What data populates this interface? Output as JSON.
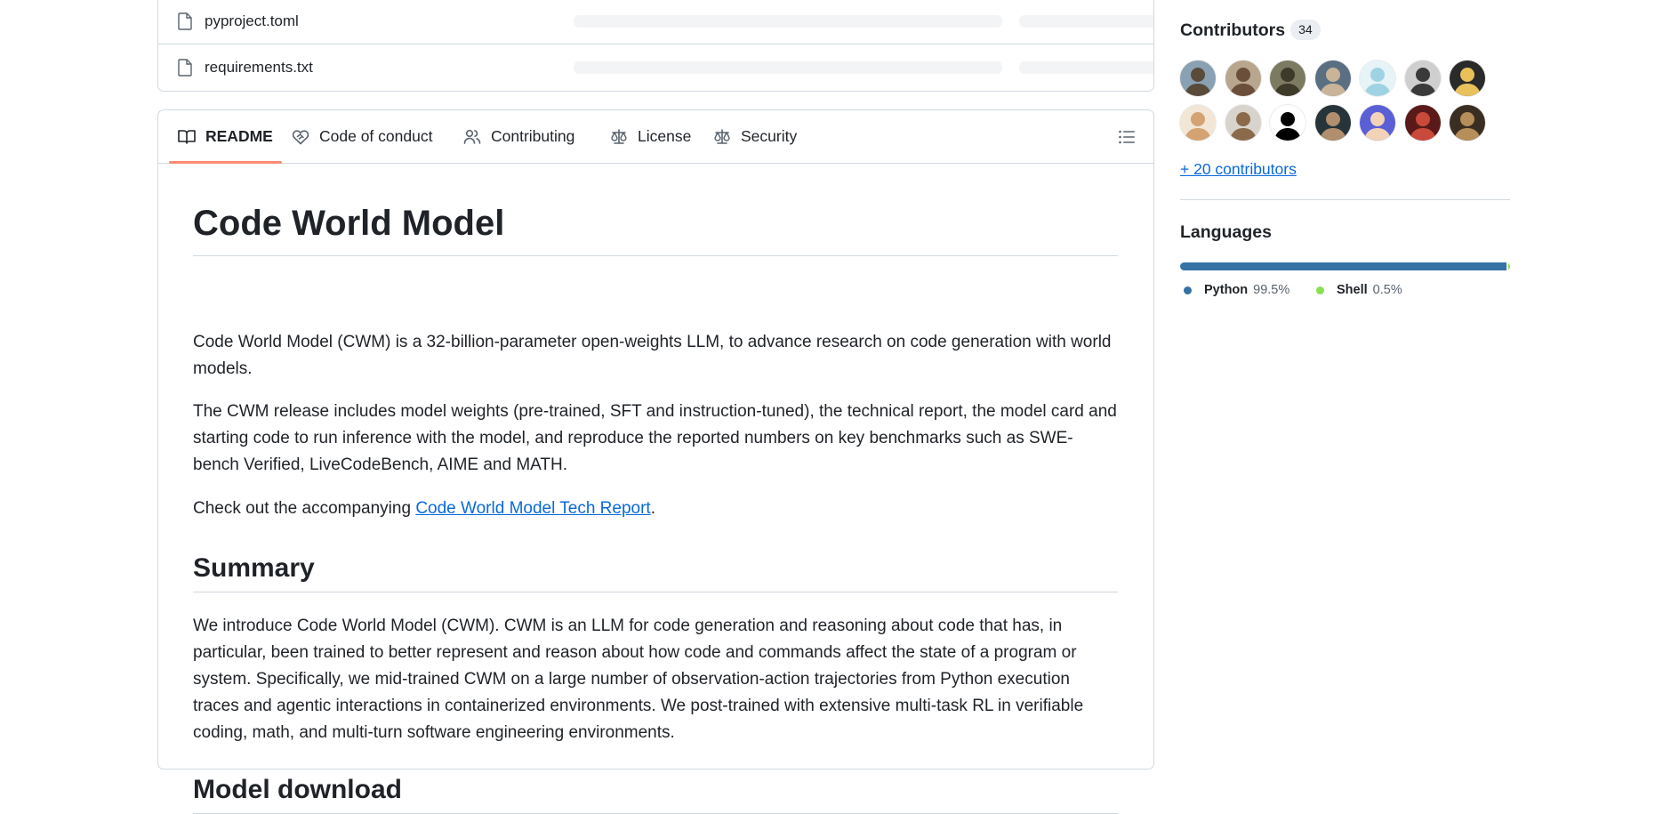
{
  "files": [
    {
      "name": "pyproject.toml"
    },
    {
      "name": "requirements.txt"
    }
  ],
  "readme_tabs": [
    {
      "label": "README",
      "icon": "book-icon",
      "active": true
    },
    {
      "label": "Code of conduct",
      "icon": "heart-handshake-icon",
      "active": false
    },
    {
      "label": "Contributing",
      "icon": "people-icon",
      "active": false
    },
    {
      "label": "License",
      "icon": "law-scale-icon",
      "active": false
    },
    {
      "label": "Security",
      "icon": "law-scale-icon",
      "active": false
    }
  ],
  "readme": {
    "title": "Code World Model",
    "intro": "Code World Model (CWM) is a 32-billion-parameter open-weights LLM, to advance research on code generation with world models.",
    "release": "The CWM release includes model weights (pre-trained, SFT and instruction-tuned), the technical report, the model card and starting code to run inference with the model, and reproduce the reported numbers on key benchmarks such as SWE-bench Verified, LiveCodeBench, AIME and MATH.",
    "check_prefix": "Check out the accompanying ",
    "check_link": "Code World Model Tech Report",
    "check_suffix": ".",
    "summary_heading": "Summary",
    "summary_text": "We introduce Code World Model (CWM). CWM is an LLM for code generation and reasoning about code that has, in particular, been trained to better represent and reason about how code and commands affect the state of a program or system. Specifically, we mid-trained CWM on a large number of observation-action trajectories from Python execution traces and agentic interactions in containerized environments. We post-trained with extensive multi-task RL in verifiable coding, math, and multi-turn software engineering environments.",
    "download_heading": "Model download"
  },
  "sidebar": {
    "contributors": {
      "title": "Contributors",
      "count": "34",
      "more_label": "+ 20 contributors",
      "avatars": [
        {
          "bg": "#8aa1b3",
          "fg": "#5a4a3a"
        },
        {
          "bg": "#b9a68f",
          "fg": "#6b4f3a"
        },
        {
          "bg": "#7d7a62",
          "fg": "#3d3a2a"
        },
        {
          "bg": "#5b6f83",
          "fg": "#c9b49a"
        },
        {
          "bg": "#e6f3f7",
          "fg": "#9fd3e3"
        },
        {
          "bg": "#cfcfcf",
          "fg": "#3a3a3a"
        },
        {
          "bg": "#2a2a2a",
          "fg": "#e8c15a"
        },
        {
          "bg": "#f2e6d6",
          "fg": "#d4a373"
        },
        {
          "bg": "#d8d3cc",
          "fg": "#8a6a4a"
        },
        {
          "bg": "#ffffff",
          "fg": "#000000"
        },
        {
          "bg": "#27343a",
          "fg": "#b08e6e"
        },
        {
          "bg": "#5b5fd6",
          "fg": "#f2d3b8"
        },
        {
          "bg": "#5a1a1a",
          "fg": "#c94a3a"
        },
        {
          "bg": "#3a2e22",
          "fg": "#b58e5a"
        }
      ]
    },
    "languages": {
      "title": "Languages",
      "items": [
        {
          "name": "Python",
          "percent": "99.5%",
          "value": 99.5,
          "color": "#3572A5"
        },
        {
          "name": "Shell",
          "percent": "0.5%",
          "value": 0.5,
          "color": "#89e051"
        }
      ]
    }
  }
}
